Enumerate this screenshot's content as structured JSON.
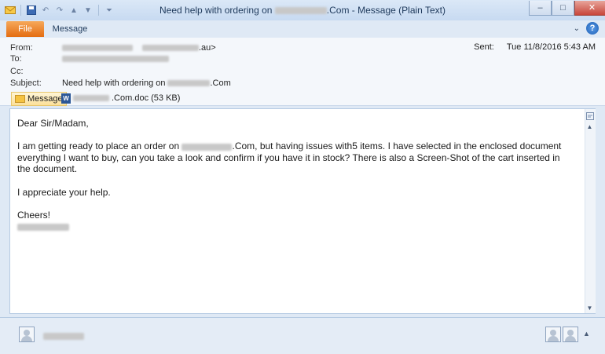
{
  "window": {
    "title_prefix": "Need help with ordering on",
    "title_suffix": ".Com  -  Message (Plain Text)",
    "controls": {
      "minimize": "–",
      "maximize": "□",
      "close": "✕"
    }
  },
  "ribbon": {
    "tabs": [
      {
        "label": "File"
      },
      {
        "label": "Message"
      }
    ],
    "help": "?",
    "collapse": "⌄"
  },
  "header": {
    "from_label": "From:",
    "from_suffix": ".au>",
    "to_label": "To:",
    "cc_label": "Cc:",
    "subject_label": "Subject:",
    "subject_prefix": "Need help with ordering on",
    "subject_suffix": ".Com",
    "sent_label": "Sent:",
    "sent_value": "Tue 11/8/2016 5:43 AM"
  },
  "attachments": {
    "message_tab": "Message",
    "file_suffix": ".Com.doc (53 KB)"
  },
  "body": {
    "greeting": "Dear Sir/Madam,",
    "p1_a": "I am getting ready to place an order on",
    "p1_b": ".Com, but having issues with5 items. I have selected in the enclosed document everything I want to buy, can you take a look and confirm if you have it in stock? There is also a Screen-Shot of the cart inserted in the document.",
    "p2": "I appreciate your help.",
    "closing": "Cheers!"
  },
  "icons": [
    "app-mail-icon",
    "save-icon",
    "undo-icon",
    "redo-icon",
    "up-arrow-icon",
    "down-arrow-icon",
    "customize-icon",
    "help-icon",
    "envelope-icon",
    "word-doc-icon",
    "scroll-up-icon",
    "scroll-down-icon",
    "contact-avatar-icon"
  ]
}
